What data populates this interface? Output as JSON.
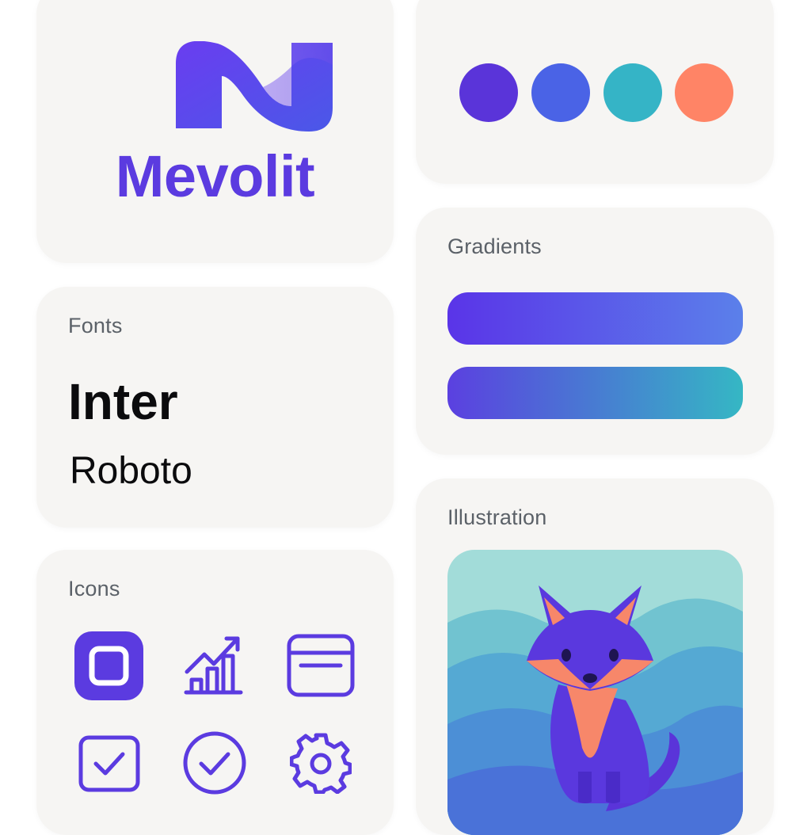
{
  "brand": {
    "name": "Mevolit",
    "logo_icon": "n-monogram-icon",
    "color": "#5b3be0"
  },
  "palette": {
    "swatches": [
      {
        "name": "violet",
        "color": "#5a34d9"
      },
      {
        "name": "blue",
        "color": "#4a63e6"
      },
      {
        "name": "teal",
        "color": "#35b4c6"
      },
      {
        "name": "coral",
        "color": "#ff8466"
      }
    ]
  },
  "fonts": {
    "title": "Fonts",
    "primary": "Inter",
    "secondary": "Roboto"
  },
  "gradients": {
    "title": "Gradients",
    "bars": [
      {
        "from": "#5a34e8",
        "to": "#5b80ea"
      },
      {
        "from": "#5b40e0",
        "to": "#35b7c4"
      }
    ]
  },
  "icons": {
    "title": "Icons",
    "color": "#5b3be0",
    "items": [
      "app-square-icon",
      "growth-chart-icon",
      "card-icon",
      "checkbox-icon",
      "check-circle-icon",
      "gear-icon"
    ]
  },
  "illustration": {
    "title": "Illustration",
    "subject": "fox-illustration"
  }
}
